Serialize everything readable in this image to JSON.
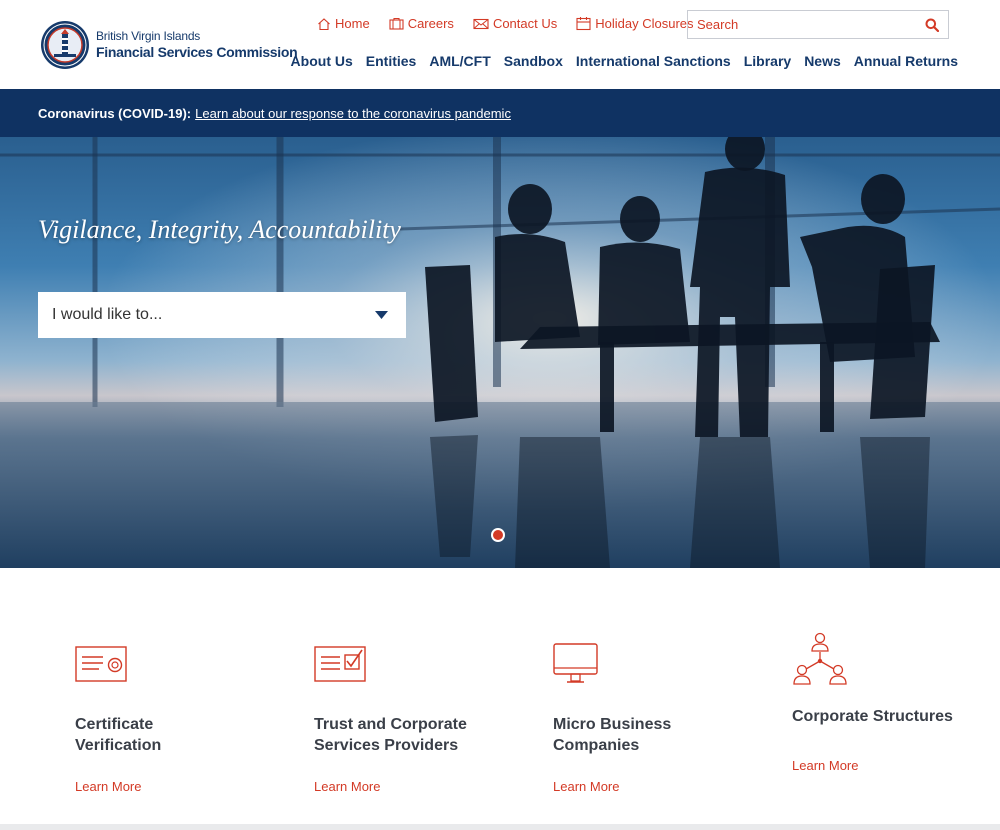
{
  "brand": {
    "line1": "British Virgin Islands",
    "line2": "Financial Services Commission"
  },
  "utility_nav": [
    {
      "label": "Home",
      "icon": "home-icon"
    },
    {
      "label": "Careers",
      "icon": "careers-icon"
    },
    {
      "label": "Contact Us",
      "icon": "mail-icon"
    },
    {
      "label": "Holiday Closures",
      "icon": "calendar-icon"
    }
  ],
  "search": {
    "placeholder": "Search"
  },
  "main_nav": [
    "About Us",
    "Entities",
    "AML/CFT",
    "Sandbox",
    "International Sanctions",
    "Library",
    "News",
    "Annual Returns"
  ],
  "alert": {
    "label": "Coronavirus (COVID-19):",
    "link": "Learn about our response to the coronavirus pandemic"
  },
  "hero": {
    "tagline": "Vigilance, Integrity, Accountability",
    "dropdown_label": "I would like to...",
    "active_slide": 1,
    "slide_count": 1
  },
  "features": [
    {
      "icon": "certificate-icon",
      "title_line1": "Certificate",
      "title_line2": "Verification",
      "link": "Learn More"
    },
    {
      "icon": "checklist-icon",
      "title_line1": "Trust and Corporate",
      "title_line2": "Services Providers",
      "link": "Learn More"
    },
    {
      "icon": "monitor-icon",
      "title_line1": "Micro Business",
      "title_line2": "Companies",
      "link": "Learn More"
    },
    {
      "icon": "org-structure-icon",
      "title_line1": "Corporate Structures",
      "title_line2": "",
      "link": "Learn More"
    }
  ],
  "colors": {
    "brand_navy": "#163a6b",
    "alert_bg": "#0f3262",
    "accent_red": "#d33a26",
    "card_title": "#3a3f48"
  }
}
